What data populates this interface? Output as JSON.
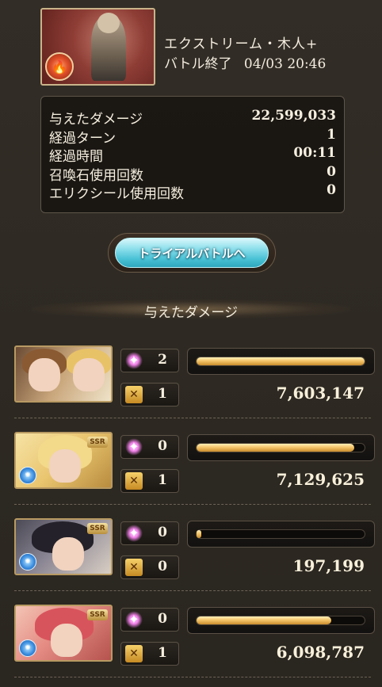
{
  "header": {
    "quest_name": "エクストリーム・木人+",
    "status": "バトル終了",
    "timestamp": "04/03 20:46",
    "element_icon": "fire-element-icon"
  },
  "stats": {
    "rows": [
      {
        "label": "与えたダメージ",
        "value": "22,599,033"
      },
      {
        "label": "経過ターン",
        "value": "1"
      },
      {
        "label": "経過時間",
        "value": "00:11"
      },
      {
        "label": "召喚石使用回数",
        "value": "0"
      },
      {
        "label": "エリクシール使用回数",
        "value": "0"
      }
    ]
  },
  "trial_button": {
    "label": "トライアルバトルへ"
  },
  "damage_section": {
    "title": "与えたダメージ"
  },
  "characters": [
    {
      "skills": "2",
      "charge_attacks": "1",
      "damage": "7,603,147",
      "bar_fraction": 1.0,
      "ssr": "",
      "element": ""
    },
    {
      "skills": "0",
      "charge_attacks": "1",
      "damage": "7,129,625",
      "bar_fraction": 0.937,
      "ssr": "SSR",
      "element": "wind"
    },
    {
      "skills": "0",
      "charge_attacks": "0",
      "damage": "197,199",
      "bar_fraction": 0.026,
      "ssr": "SSR",
      "element": "wind"
    },
    {
      "skills": "0",
      "charge_attacks": "1",
      "damage": "6,098,787",
      "bar_fraction": 0.802,
      "ssr": "SSR",
      "element": "wind"
    }
  ],
  "icons": {
    "skill": "skill-sparkle-icon",
    "charge_attack": "charge-attack-icon"
  }
}
